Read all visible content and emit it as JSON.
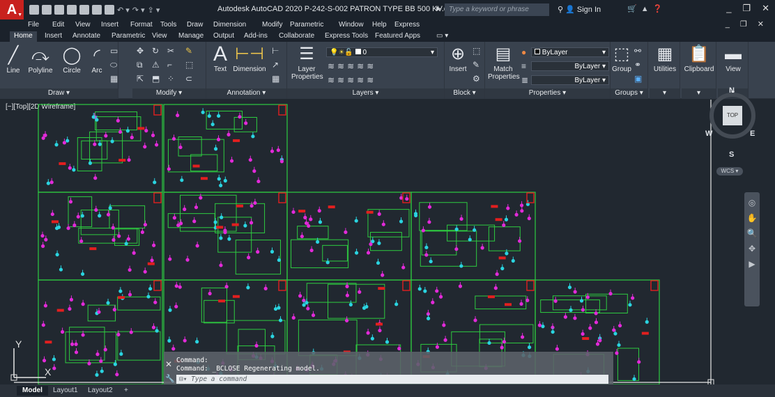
{
  "app": {
    "title": "Autodesk AutoCAD 2020   P-242-S-002 PATRON TYPE BB 500 KV.dwg",
    "logo_letter": "A",
    "search_placeholder": "Type a keyword or phrase",
    "sign_in": "Sign In"
  },
  "menu": [
    "File",
    "Edit",
    "View",
    "Insert",
    "Format",
    "Tools",
    "Draw",
    "Dimension",
    "Modify",
    "Parametric",
    "Window",
    "Help",
    "Express"
  ],
  "ribbon_tabs": [
    "Home",
    "Insert",
    "Annotate",
    "Parametric",
    "View",
    "Manage",
    "Output",
    "Add-ins",
    "Collaborate",
    "Express Tools",
    "Featured Apps"
  ],
  "ribbon": {
    "draw": {
      "title": "Draw",
      "line": "Line",
      "polyline": "Polyline",
      "circle": "Circle",
      "arc": "Arc"
    },
    "modify": {
      "title": "Modify"
    },
    "annotation": {
      "title": "Annotation",
      "text": "Text",
      "dimension": "Dimension"
    },
    "layers": {
      "title": "Layers",
      "layer_properties_1": "Layer",
      "layer_properties_2": "Properties",
      "current_layer": "0"
    },
    "block": {
      "title": "Block",
      "insert": "Insert"
    },
    "properties": {
      "title": "Properties",
      "match_1": "Match",
      "match_2": "Properties",
      "color": "ByLayer",
      "linetype": "ByLayer",
      "lineweight": "ByLayer"
    },
    "groups": {
      "title": "Groups",
      "group": "Group"
    },
    "utilities": "Utilities",
    "clipboard": "Clipboard",
    "view": "View"
  },
  "canvas": {
    "view_label": "[−][Top][2D Wireframe]",
    "viewcube_face": "TOP",
    "compass": {
      "n": "N",
      "s": "S",
      "e": "E",
      "w": "W"
    },
    "wcs": "WCS",
    "ucs_x": "X",
    "ucs_y": "Y"
  },
  "command": {
    "line1": "Command:",
    "line2": "Command: _BCLOSE Regenerating model.",
    "placeholder": "Type a command"
  },
  "layout_tabs": [
    "Model",
    "Layout1",
    "Layout2"
  ],
  "colors": {
    "accent_red": "#c8211e",
    "sheet_green": "#2ecc40",
    "magenta": "#e22ad9",
    "cyan": "#2ad4e0",
    "red_mark": "#e21f1f"
  }
}
